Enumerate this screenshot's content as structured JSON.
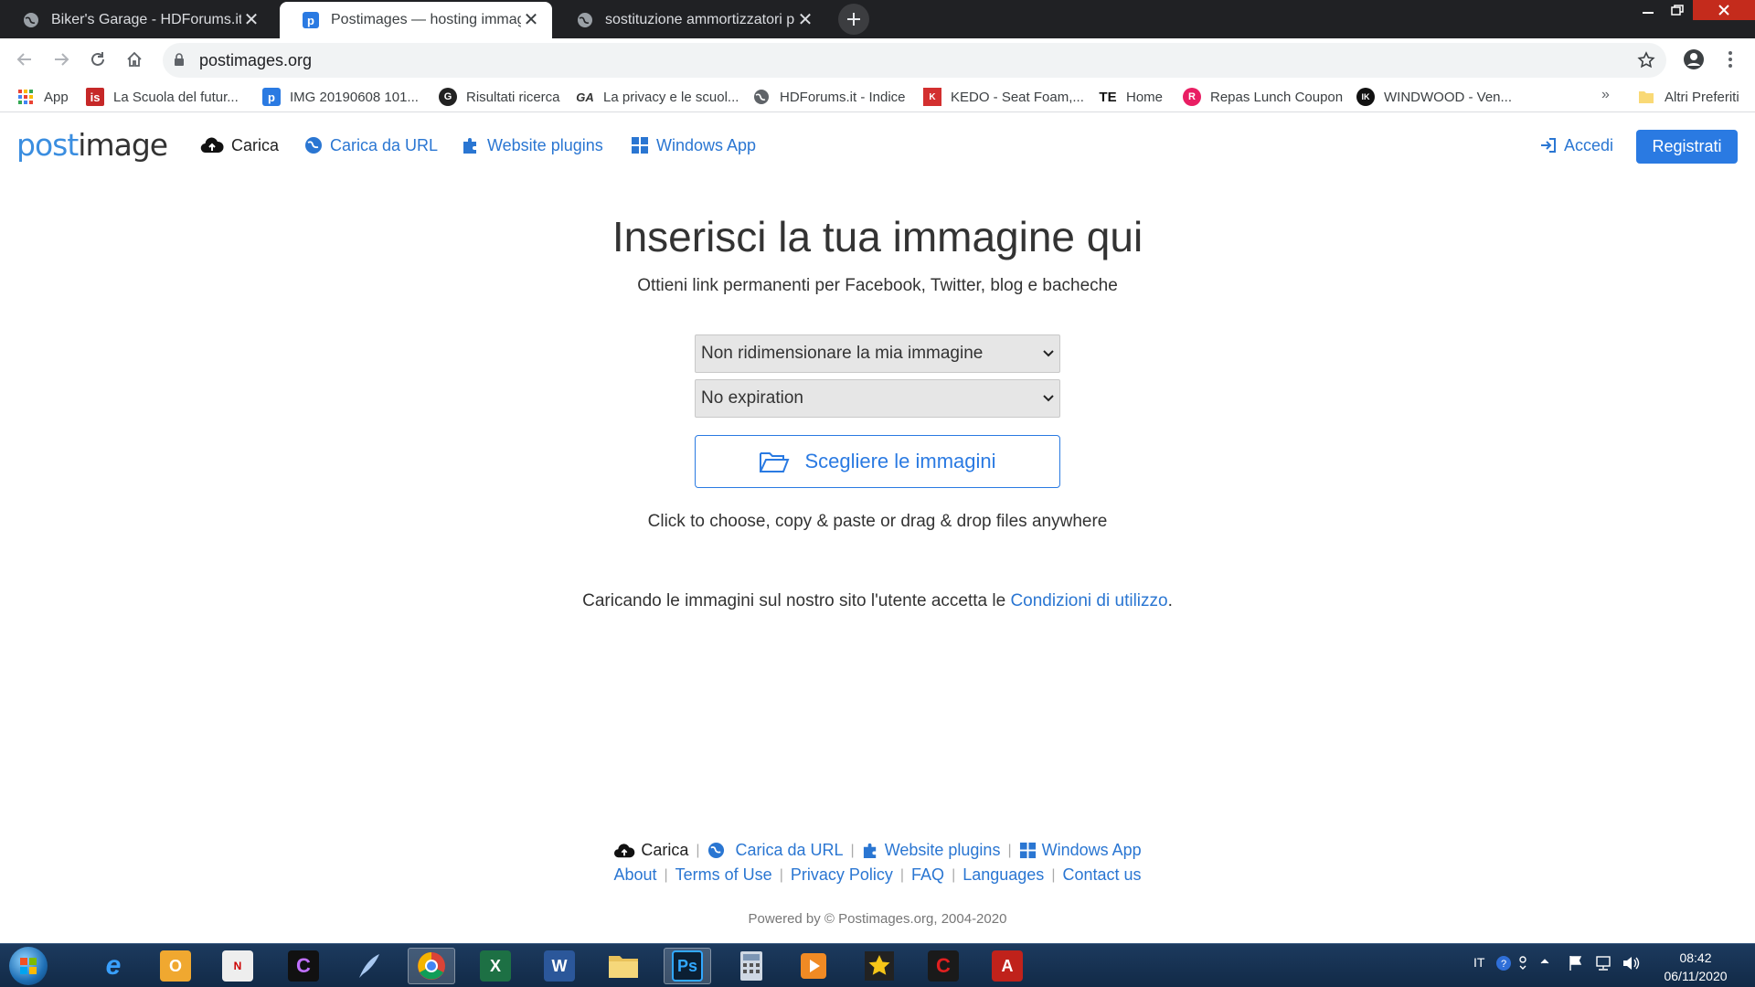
{
  "browser": {
    "tabs": [
      {
        "title": "Biker's Garage - HDForums.it",
        "icon": "globe-icon",
        "active": false
      },
      {
        "title": "Postimages — hosting immagini",
        "icon": "postimage-favicon",
        "active": true
      },
      {
        "title": "sostituzione ammortizzatori post",
        "icon": "globe-icon",
        "active": false
      }
    ],
    "close_glyph": "✕",
    "url": "postimages.org",
    "bookmarks": [
      {
        "label": "App",
        "icon": "apps-grid-icon"
      },
      {
        "label": "La Scuola del futur...",
        "icon": "is-icon"
      },
      {
        "label": "IMG 20190608 101...",
        "icon": "postimage-favicon"
      },
      {
        "label": "Risultati ricerca",
        "icon": "round-logo-icon"
      },
      {
        "label": "La privacy e le scuol...",
        "icon": "ga-icon"
      },
      {
        "label": "HDForums.it - Indice",
        "icon": "globe-icon"
      },
      {
        "label": "KEDO - Seat Foam,...",
        "icon": "kedo-icon"
      },
      {
        "label": "Home",
        "icon": "te-icon"
      },
      {
        "label": "Repas Lunch Coupon",
        "icon": "repas-icon"
      },
      {
        "label": "WINDWOOD - Ven...",
        "icon": "ik-icon"
      }
    ],
    "more_bookmarks": "»",
    "other_bookmarks": "Altri Preferiti"
  },
  "site": {
    "logo": {
      "part1": "post",
      "part2": "image"
    },
    "nav": {
      "upload": "Carica",
      "from_url": "Carica da URL",
      "plugins": "Website plugins",
      "windows_app": "Windows App",
      "login": "Accedi",
      "register": "Registrati"
    },
    "main": {
      "title": "Inserisci la tua immagine qui",
      "subtitle": "Ottieni link permanenti per Facebook, Twitter, blog e bacheche",
      "resize_select": "Non ridimensionare la mia immagine",
      "expiration_select": "No expiration",
      "choose_button": "Scegliere le immagini",
      "hint": "Click to choose, copy & paste or drag & drop files anywhere",
      "terms_prefix": "Caricando le immagini sul nostro sito l'utente accetta le ",
      "terms_link": "Condizioni di utilizzo",
      "terms_suffix": "."
    },
    "footer": {
      "upload": "Carica",
      "from_url": "Carica da URL",
      "plugins": "Website plugins",
      "windows_app": "Windows App",
      "links": [
        "About",
        "Terms of Use",
        "Privacy Policy",
        "FAQ",
        "Languages",
        "Contact us"
      ],
      "separator": "|",
      "powered": "Powered by © Postimages.org, 2004-2020"
    }
  },
  "taskbar": {
    "language": "IT",
    "time": "08:42",
    "date": "06/11/2020",
    "apps": [
      "internet-explorer-icon",
      "outlook-icon",
      "nikon-transfer-icon",
      "capture-nx-icon",
      "feather-icon",
      "chrome-icon",
      "excel-icon",
      "word-icon",
      "file-explorer-icon",
      "photoshop-icon",
      "calculator-icon",
      "media-player-icon",
      "movie-star-icon",
      "cyberlink-icon",
      "acrobat-icon"
    ]
  },
  "colors": {
    "link": "#2a76d2",
    "primary_button": "#2a7ae2",
    "tab_strip": "#202124",
    "taskbar": "#1c3a5e"
  }
}
